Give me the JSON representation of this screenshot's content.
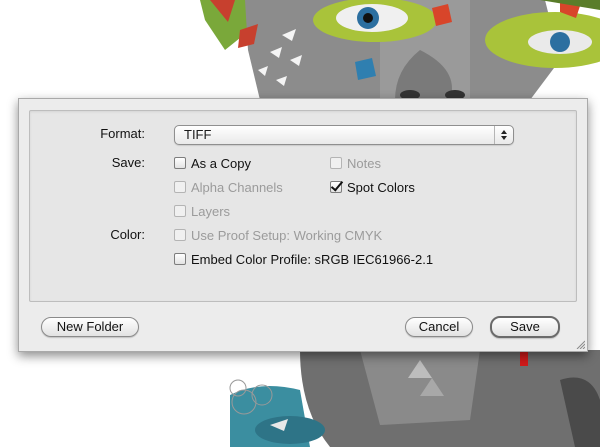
{
  "dialog": {
    "format": {
      "label": "Format:",
      "value": "TIFF"
    },
    "save_section": {
      "label": "Save:",
      "options": [
        {
          "label": "As a Copy",
          "checked": false,
          "enabled": true
        },
        {
          "label": "Notes",
          "checked": false,
          "enabled": false
        },
        {
          "label": "Alpha Channels",
          "checked": false,
          "enabled": false
        },
        {
          "label": "Spot Colors",
          "checked": true,
          "enabled": true
        },
        {
          "label": "Layers",
          "checked": false,
          "enabled": false
        }
      ]
    },
    "color_section": {
      "label": "Color:",
      "options": [
        {
          "label": "Use Proof Setup:  Working CMYK",
          "checked": false,
          "enabled": false
        },
        {
          "label": "Embed Color Profile:  sRGB IEC61966-2.1",
          "checked": false,
          "enabled": true
        }
      ]
    },
    "buttons": {
      "new_folder": "New Folder",
      "cancel": "Cancel",
      "save": "Save"
    }
  },
  "colors": {
    "annotation_arrow": "#d11a1a",
    "dialog_bg": "#ececec",
    "panel_bg": "#e6e6e6",
    "face_grey": "#8e8e8e",
    "makeup_green": "#a9c33a",
    "teal": "#3b8ea0"
  },
  "icons": {
    "select_stepper": "up-down-arrows-icon",
    "resize_grip": "resize-grip-icon",
    "annotation": "red-arrow-icon"
  }
}
